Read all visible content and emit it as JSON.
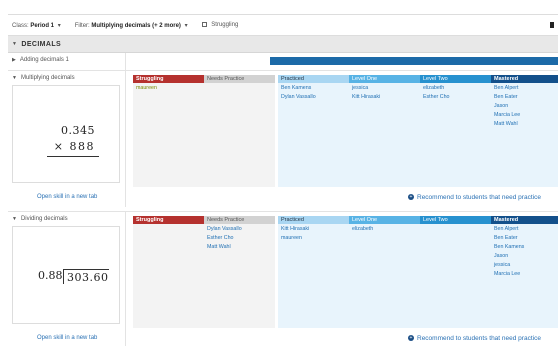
{
  "toolbar": {
    "class_label": "Class:",
    "class_value": "Period 1",
    "filter_label": "Filter:",
    "filter_value": "Multiplying decimals (+ 2 more)",
    "struggling_label": "Struggling"
  },
  "section": {
    "title": "DECIMALS"
  },
  "skills": [
    {
      "name": "Adding decimals 1"
    },
    {
      "name": "Multiplying decimals",
      "problem": {
        "top": "0.345",
        "bottom": "× 888"
      },
      "open_link": "Open skill in a new tab",
      "recommend": "Recommend to students that need practice",
      "columns": {
        "struggling": {
          "label": "Struggling",
          "students": [
            "maureen"
          ]
        },
        "needs": {
          "label": "Needs Practice",
          "students": []
        },
        "practiced": {
          "label": "Practiced",
          "students": [
            "Ben Kamens",
            "Dylan Vassallo"
          ]
        },
        "level_one": {
          "label": "Level One",
          "students": [
            "jessica",
            "Kitt Hirasaki"
          ]
        },
        "level_two": {
          "label": "Level Two",
          "students": [
            "elizabeth",
            "Esther Cho"
          ]
        },
        "mastered": {
          "label": "Mastered",
          "students": [
            "Ben Alpert",
            "Ben Eater",
            "Jason",
            "Marcia Lee",
            "Matt Wahl"
          ]
        }
      }
    },
    {
      "name": "Dividing decimals",
      "problem": {
        "divisor": "0.88",
        "dividend": "303.60"
      },
      "open_link": "Open skill in a new tab",
      "recommend": "Recommend to students that need practice",
      "columns": {
        "struggling": {
          "label": "Struggling",
          "students": []
        },
        "needs": {
          "label": "Needs Practice",
          "students": [
            "Dylan Vassallo",
            "Esther Cho",
            "Matt Wahl"
          ]
        },
        "practiced": {
          "label": "Practiced",
          "students": [
            "Kitt Hirasaki",
            "maureen"
          ]
        },
        "level_one": {
          "label": "Level One",
          "students": [
            "elizabeth"
          ]
        },
        "level_two": {
          "label": "Level Two",
          "students": []
        },
        "mastered": {
          "label": "Mastered",
          "students": [
            "Ben Alpert",
            "Ben Eater",
            "Ben Kamens",
            "Jason",
            "jessica",
            "Marcia Lee"
          ]
        }
      }
    }
  ]
}
